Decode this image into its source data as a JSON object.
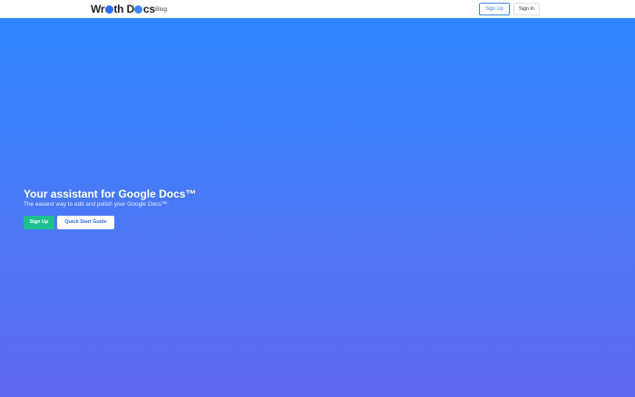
{
  "navbar": {
    "logo_part1": "Wr",
    "logo_part2": "th D",
    "logo_part3": "cs",
    "blog_label": "Blog",
    "signup_label": "Sign Up",
    "signin_label": "Sign In"
  },
  "hero": {
    "title": "Your assistant for Google Docs™",
    "subtitle": "The easiest way to edit and polish your Google Docs™.",
    "signup_label": "Sign Up",
    "quickstart_label": "Quick Start Guide"
  },
  "colors": {
    "accent": "#3b86ff",
    "hero_gradient_top": "#2e86ff",
    "hero_gradient_bottom": "#5f67ee",
    "signup_green": "#1dbf8f"
  }
}
